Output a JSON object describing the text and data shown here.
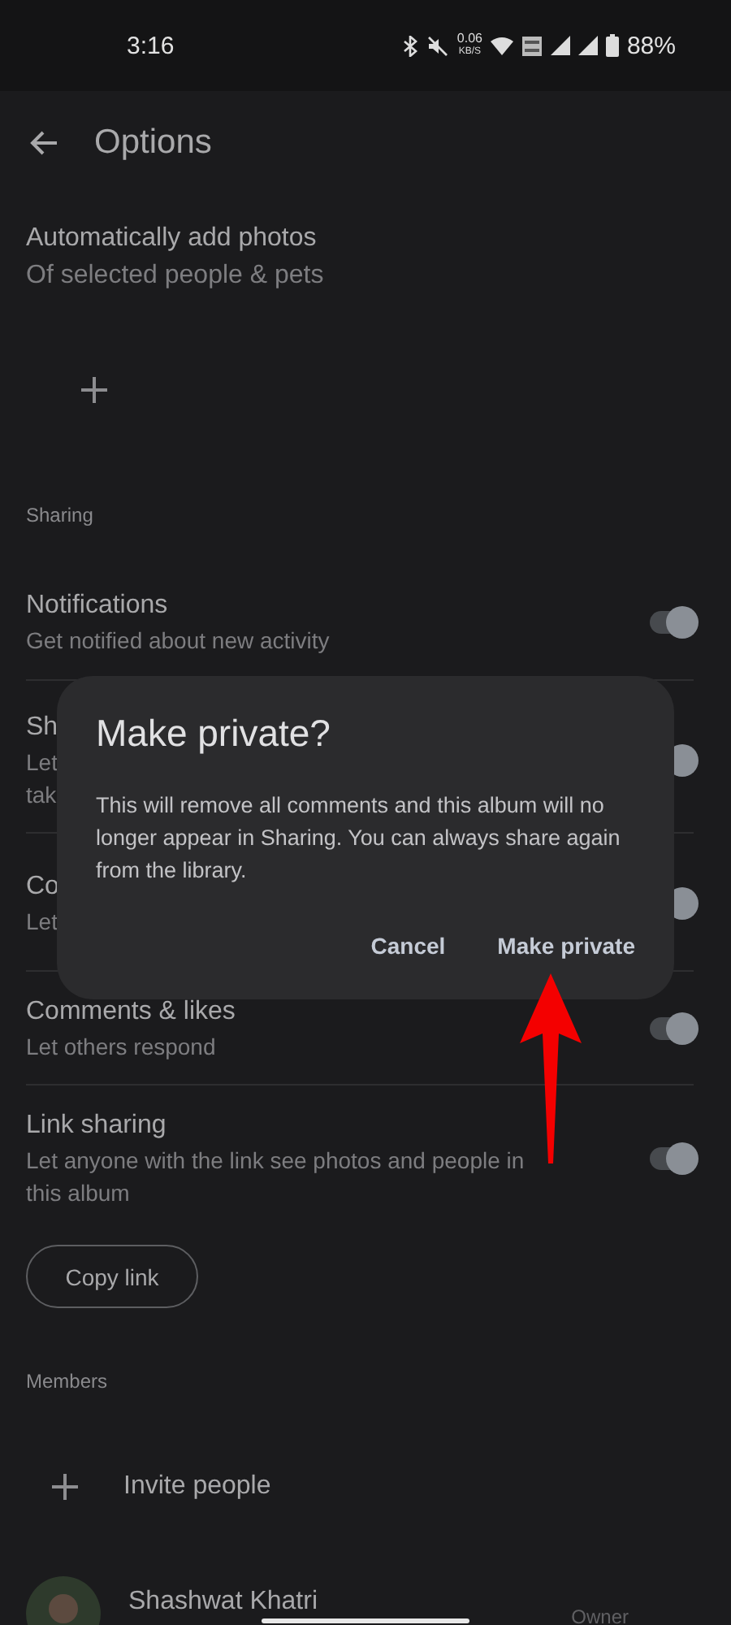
{
  "status_bar": {
    "time": "3:16",
    "data_rate": "0.06",
    "data_unit": "KB/S",
    "battery": "88%"
  },
  "app_bar": {
    "title": "Options"
  },
  "auto_add": {
    "title": "Automatically add photos",
    "subtitle": "Of selected people & pets"
  },
  "sharing": {
    "heading": "Sharing",
    "rows": [
      {
        "title": "Notifications",
        "subtitle_lines": [
          "Get notified about new activity"
        ],
        "on": true
      },
      {
        "title": "Sh",
        "subtitle_lines": [
          "Let",
          "tak"
        ],
        "on": true
      },
      {
        "title": "Co",
        "subtitle_lines": [
          "Let"
        ],
        "on": true
      },
      {
        "title": "Comments & likes",
        "subtitle_lines": [
          "Let others respond"
        ],
        "on": true
      },
      {
        "title": "Link sharing",
        "subtitle_lines": [
          "Let anyone with the link see photos and people in this album"
        ],
        "on": true
      }
    ],
    "copy_button": "Copy link"
  },
  "members": {
    "heading": "Members",
    "invite": "Invite people",
    "people": [
      {
        "name": "Shashwat Khatri",
        "role": "Owner"
      }
    ]
  },
  "dialog": {
    "title": "Make private?",
    "message": "This will remove all comments and this album will no longer appear in Sharing. You can always share again from the library.",
    "actions": [
      {
        "label": "Cancel"
      },
      {
        "label": "Make private"
      }
    ]
  }
}
